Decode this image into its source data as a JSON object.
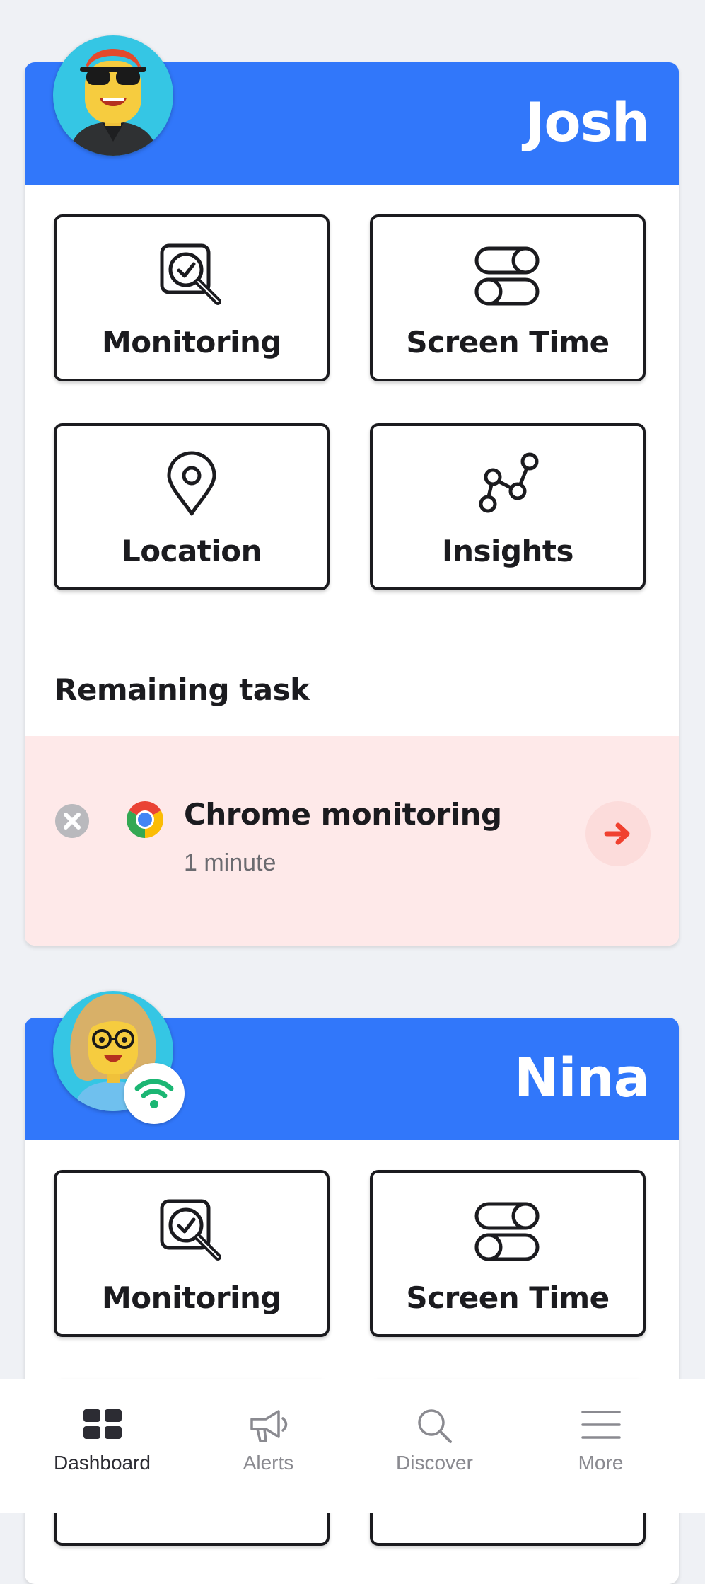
{
  "profiles": [
    {
      "name": "Josh",
      "tiles": [
        "Monitoring",
        "Screen Time",
        "Location",
        "Insights"
      ],
      "remaining_task": {
        "section_title": "Remaining task",
        "title": "Chrome monitoring",
        "subtitle": "1 minute"
      }
    },
    {
      "name": "Nina",
      "tiles": [
        "Monitoring",
        "Screen Time"
      ]
    }
  ],
  "tabbar": {
    "items": [
      {
        "label": "Dashboard",
        "icon": "dashboard-icon",
        "active": true
      },
      {
        "label": "Alerts",
        "icon": "megaphone-icon",
        "active": false
      },
      {
        "label": "Discover",
        "icon": "search-icon",
        "active": false
      },
      {
        "label": "More",
        "icon": "menu-icon",
        "active": false
      }
    ]
  },
  "colors": {
    "header_blue": "#3177fa",
    "task_background": "#fee9e9",
    "arrow_red": "#f0412f",
    "wifi_green": "#1bb673"
  }
}
